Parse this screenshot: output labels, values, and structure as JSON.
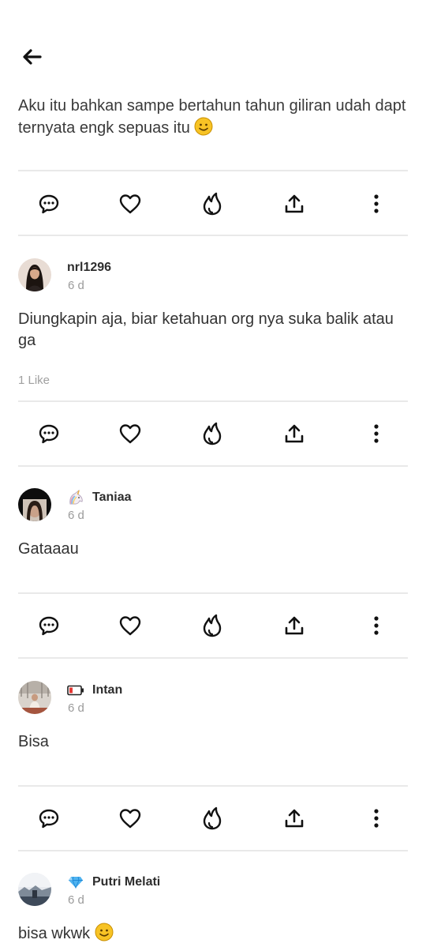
{
  "post": {
    "text": "Aku itu bahkan sampe bertahun tahun giliran udah dapt ternyata engk sepuas itu"
  },
  "comments": [
    {
      "username": "nrl1296",
      "time": "6 d",
      "text": "Diungkapin aja, biar ketahuan org nya suka balik atau ga",
      "likes": "1 Like"
    },
    {
      "username": "Taniaa",
      "time": "6 d",
      "text": "Gataaau"
    },
    {
      "username": "Intan",
      "time": "6 d",
      "text": "Bisa"
    },
    {
      "username": "Putri Melati",
      "time": "6 d",
      "text": "bisa wkwk"
    }
  ],
  "icons": {
    "back": "arrow-left-icon",
    "actions": [
      "comment-icon",
      "heart-icon",
      "fire-icon",
      "share-icon",
      "more-icon"
    ],
    "badges": [
      "unicorn-icon",
      "battery-icon",
      "diamond-icon"
    ],
    "emoji": "smile-emoji-icon"
  },
  "colors": {
    "icon": "#111111",
    "divider": "#e9e9e9",
    "muted_text": "#9b9b9b",
    "emoji": "#f7c325"
  }
}
